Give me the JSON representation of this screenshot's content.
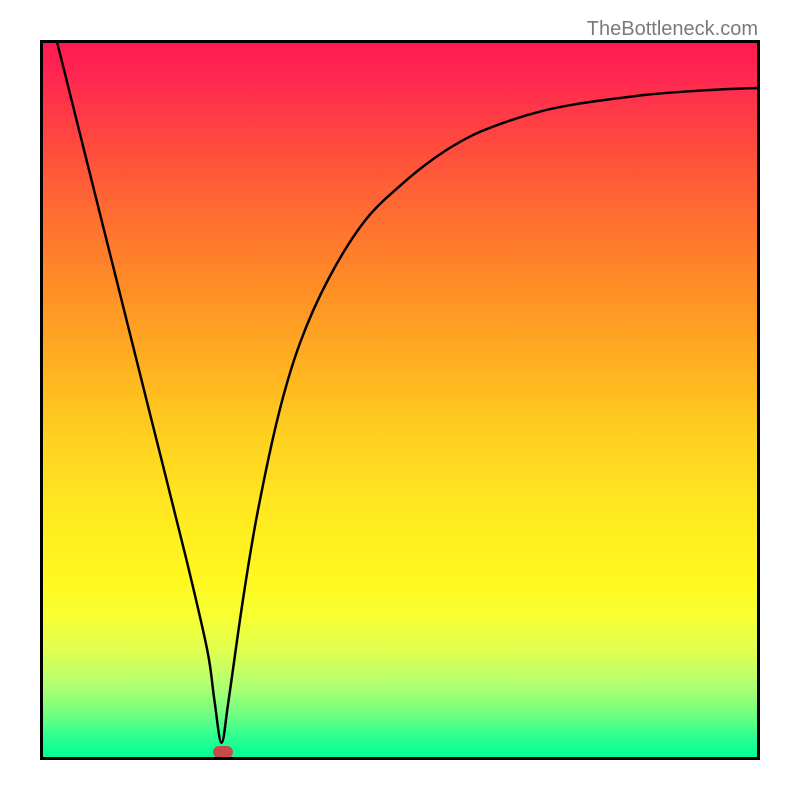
{
  "watermark": "TheBottleneck.com",
  "chart_data": {
    "type": "line",
    "title": "",
    "xlabel": "",
    "ylabel": "",
    "xlim": [
      0,
      100
    ],
    "ylim": [
      0,
      100
    ],
    "series": [
      {
        "name": "curve",
        "x": [
          2,
          5,
          10,
          15,
          20,
          23,
          24,
          25,
          26,
          28,
          30,
          33,
          36,
          40,
          45,
          50,
          55,
          60,
          65,
          70,
          75,
          80,
          85,
          90,
          95,
          100
        ],
        "y": [
          100,
          88,
          68,
          48,
          28,
          15,
          8,
          2,
          8,
          22,
          34,
          48,
          58,
          67,
          75,
          80,
          84,
          87,
          89,
          90.5,
          91.5,
          92.2,
          92.8,
          93.2,
          93.5,
          93.7
        ]
      }
    ],
    "marker": {
      "x": 25,
      "y": 1.5,
      "color": "#c94a4a"
    },
    "gradient_stops": [
      {
        "pos": 0,
        "color": "#ff1a52"
      },
      {
        "pos": 50,
        "color": "#ffd020"
      },
      {
        "pos": 80,
        "color": "#f8ff30"
      },
      {
        "pos": 100,
        "color": "#00ff95"
      }
    ]
  }
}
